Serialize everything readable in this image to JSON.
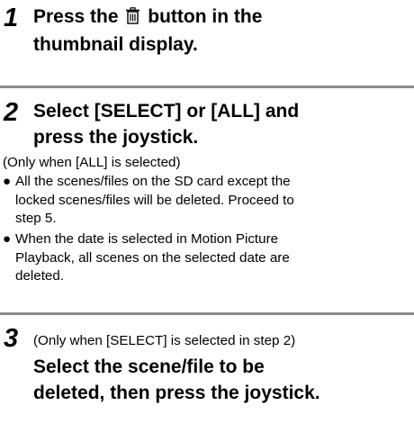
{
  "step1": {
    "number": "1",
    "title_before_icon": "Press the",
    "icon": "trash-icon",
    "title_after_icon": "button in the",
    "title_line2": "thumbnail display."
  },
  "step2": {
    "number": "2",
    "title_line1": "Select [SELECT] or [ALL] and",
    "title_line2": "press the joystick.",
    "note": "(Only when [ALL] is selected)",
    "bullets": [
      {
        "symbol": "●",
        "lines": [
          "All the scenes/files on the SD card except the",
          "locked scenes/files will be deleted. Proceed to",
          "step 5."
        ]
      },
      {
        "symbol": "●",
        "lines": [
          "When the date is selected in Motion Picture",
          "Playback, all scenes on the selected date are",
          "deleted."
        ]
      }
    ]
  },
  "step3": {
    "number": "3",
    "note": "(Only when [SELECT] is selected in step 2)",
    "title_line1": "Select the scene/file to be",
    "title_line2": "deleted, then press the joystick."
  },
  "colors": {
    "divider": "#8c8c8c",
    "text": "#000000"
  }
}
